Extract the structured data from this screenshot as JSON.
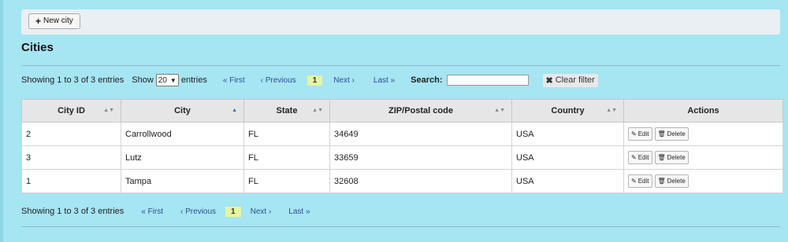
{
  "toolbar": {
    "new_city_label": "New city"
  },
  "page_title": "Cities",
  "top_controls": {
    "showing": "Showing 1 to 3 of 3 entries",
    "show_label": "Show",
    "page_size": "20",
    "entries_label": "entries",
    "first": "« First",
    "previous": "‹ Previous",
    "current_page": "1",
    "next": "Next ›",
    "last": "Last »",
    "search_label": "Search:",
    "search_value": "",
    "clear_filter": "Clear filter"
  },
  "bottom_controls": {
    "showing": "Showing 1 to 3 of 3 entries",
    "first": "« First",
    "previous": "‹ Previous",
    "current_page": "1",
    "next": "Next ›",
    "last": "Last »"
  },
  "table": {
    "columns": [
      "City ID",
      "City",
      "State",
      "ZIP/Postal code",
      "Country",
      "Actions"
    ],
    "rows": [
      {
        "id": "2",
        "city": "Carrollwood",
        "state": "FL",
        "zip": "34649",
        "country": "USA"
      },
      {
        "id": "3",
        "city": "Lutz",
        "state": "FL",
        "zip": "33659",
        "country": "USA"
      },
      {
        "id": "1",
        "city": "Tampa",
        "state": "FL",
        "zip": "32608",
        "country": "USA"
      }
    ],
    "edit_label": "Edit",
    "delete_label": "Delete"
  },
  "icons": {
    "sort": "sort-icon",
    "sort_active": "sort-asc-icon",
    "edit": "pencil-icon",
    "delete": "trash-icon",
    "clear": "x-icon",
    "plus": "plus-icon"
  },
  "colors": {
    "background": "#a6e5f2",
    "current_page": "#e6f5a0",
    "link": "#2b4f8f"
  }
}
